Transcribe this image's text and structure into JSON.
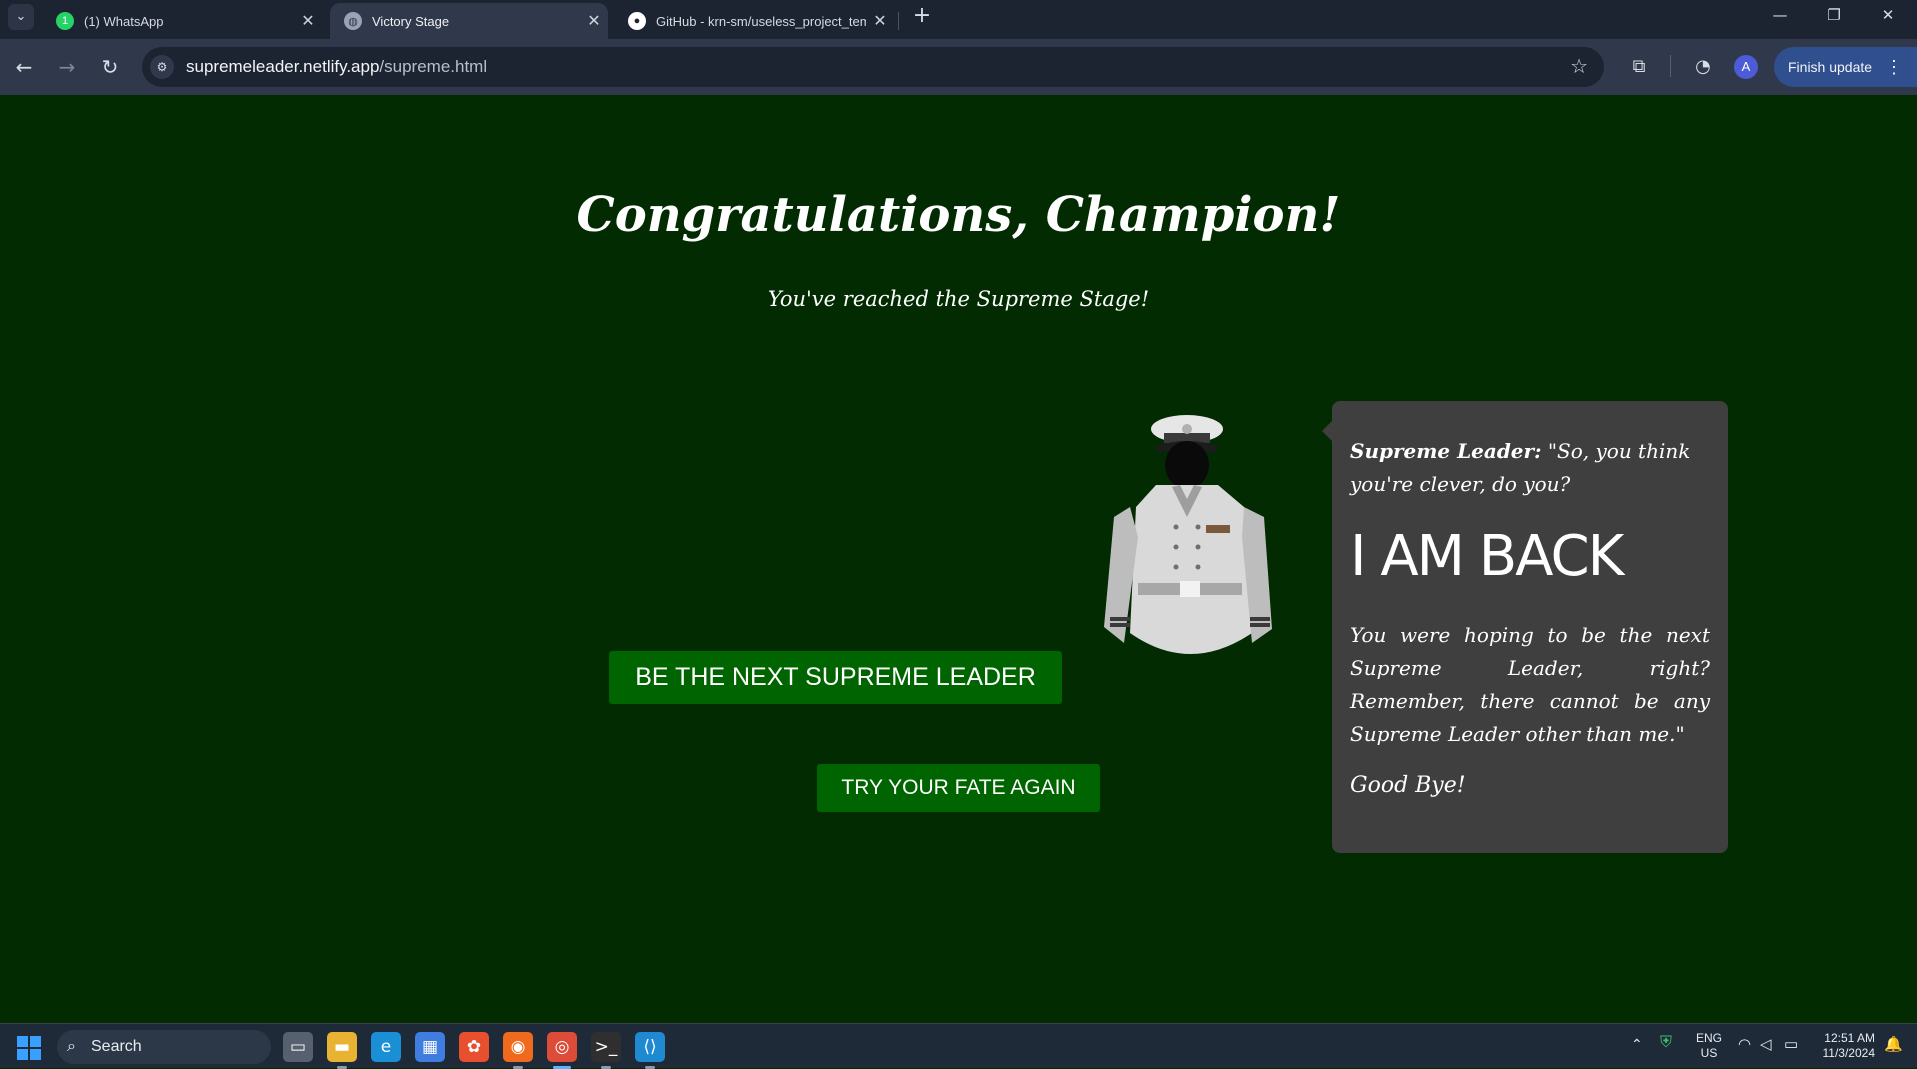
{
  "browser": {
    "tabs": [
      {
        "title": "(1) WhatsApp",
        "favicon": "whatsapp-icon"
      },
      {
        "title": "Victory Stage",
        "favicon": "globe-icon"
      },
      {
        "title": "GitHub - krn-sm/useless_project_temp",
        "favicon": "github-icon"
      }
    ],
    "url_host": "supremeleader.netlify.app",
    "url_path": "/supreme.html",
    "profile_initial": "A",
    "finish_update": "Finish update"
  },
  "page": {
    "title": "Congratulations, Champion!",
    "subtitle": "You've reached the Supreme Stage!",
    "buttons": {
      "next_leader": "BE THE NEXT SUPREME LEADER",
      "try_again": "TRY YOUR FATE AGAIN"
    },
    "speech": {
      "speaker": "Supreme Leader:",
      "intro": " \"So, you think you're clever, do you?",
      "headline": "I AM BACK",
      "body": "You were hoping to be the next Supreme Leader, right? Remember, there cannot be any Supreme Leader other than me.\"",
      "farewell": "Good Bye!"
    }
  },
  "taskbar": {
    "search_label": "Search",
    "language": "ENG",
    "region": "US",
    "time": "12:51 AM",
    "date": "11/3/2024"
  },
  "colors": {
    "page_background": "#022b02",
    "button_green": "#006400",
    "speech_bubble": "#3f3f3f"
  }
}
